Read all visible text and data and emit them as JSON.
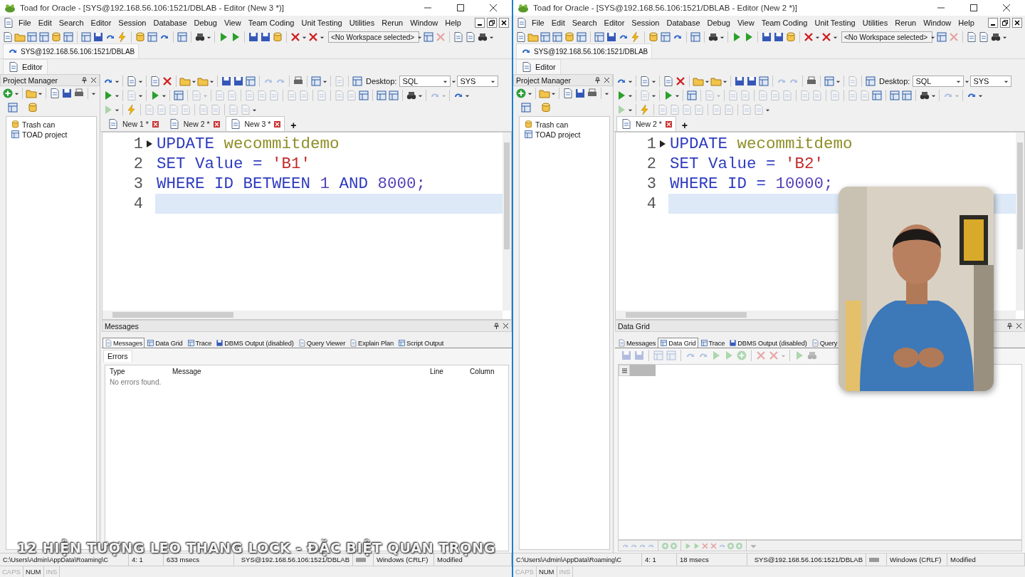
{
  "windows": [
    {
      "title": "Toad for Oracle - [SYS@192.168.56.106:1521/DBLAB - Editor (New 3 *)]",
      "menu": [
        "File",
        "Edit",
        "Search",
        "Editor",
        "Session",
        "Database",
        "Debug",
        "View",
        "Team Coding",
        "Unit Testing",
        "Utilities",
        "Rerun",
        "Window",
        "Help"
      ],
      "workspace": "<No Workspace selected>",
      "connection": "SYS@192.168.56.106:1521/DBLAB",
      "editor_tab": "Editor",
      "project_manager": {
        "title": "Project Manager",
        "items": [
          "Trash can",
          "TOAD project"
        ]
      },
      "desktop_label": "Desktop:",
      "desktop_value": "SQL",
      "schema": "SYS",
      "doc_tabs": [
        {
          "label": "New 1 *",
          "selected": false
        },
        {
          "label": "New 2 *",
          "selected": false
        },
        {
          "label": "New 3 *",
          "selected": true
        }
      ],
      "add_tab": "+",
      "code_lines": [
        {
          "number": "1",
          "marker": true,
          "current": false,
          "tokens": [
            {
              "text": "UPDATE",
              "kind": "keyword"
            },
            {
              "text": "wecommitdemo",
              "kind": "name"
            }
          ]
        },
        {
          "number": "2",
          "marker": false,
          "current": false,
          "tokens": [
            {
              "text": "SET",
              "kind": "keyword"
            },
            {
              "text": "Value",
              "kind": "keyword"
            },
            {
              "text": "=",
              "kind": "keyword"
            },
            {
              "text": "'B1'",
              "kind": "string"
            }
          ]
        },
        {
          "number": "3",
          "marker": false,
          "current": false,
          "tokens": [
            {
              "text": "WHERE",
              "kind": "keyword"
            },
            {
              "text": "ID",
              "kind": "keyword"
            },
            {
              "text": "BETWEEN",
              "kind": "keyword"
            },
            {
              "text": "1",
              "kind": "number"
            },
            {
              "text": "AND",
              "kind": "keyword"
            },
            {
              "text": "8000;",
              "kind": "number"
            }
          ]
        },
        {
          "number": "4",
          "marker": false,
          "current": true
        }
      ],
      "panel": {
        "kind": "messages",
        "title": "Messages",
        "tabs": [
          {
            "label": "Messages",
            "selected": true
          },
          {
            "label": "Data Grid",
            "selected": false
          },
          {
            "label": "Trace",
            "selected": false
          },
          {
            "label": "DBMS Output (disabled)",
            "selected": false
          },
          {
            "label": "Query Viewer",
            "selected": false
          },
          {
            "label": "Explain Plan",
            "selected": false
          },
          {
            "label": "Script Output",
            "selected": false
          }
        ],
        "subtab": "Errors",
        "columns": [
          "Type",
          "Message",
          "Line",
          "Column"
        ],
        "empty_text": "No errors found."
      },
      "status": {
        "path": "C:\\Users\\Admin\\AppData\\Roaming\\C",
        "position": "4:  1",
        "time": "633 msecs",
        "connection": "SYS@192.168.56.106:1521/DBLAB",
        "line_ending": "Windows (CRLF)",
        "state": "Modified"
      },
      "keys": [
        {
          "label": "CAPS",
          "on": false
        },
        {
          "label": "NUM",
          "on": true
        },
        {
          "label": "INS",
          "on": false
        }
      ]
    },
    {
      "title": "Toad for Oracle - [SYS@192.168.56.106:1521/DBLAB - Editor (New 2 *)]",
      "menu": [
        "File",
        "Edit",
        "Search",
        "Editor",
        "Session",
        "Database",
        "Debug",
        "View",
        "Team Coding",
        "Unit Testing",
        "Utilities",
        "Rerun",
        "Window",
        "Help"
      ],
      "workspace": "<No Workspace selected>",
      "connection": "SYS@192.168.56.106:1521/DBLAB",
      "editor_tab": "Editor",
      "project_manager": {
        "title": "Project Manager",
        "items": [
          "Trash can",
          "TOAD project"
        ]
      },
      "desktop_label": "Desktop:",
      "desktop_value": "SQL",
      "schema": "SYS",
      "doc_tabs": [
        {
          "label": "New 2 *",
          "selected": true
        }
      ],
      "add_tab": "+",
      "code_lines": [
        {
          "number": "1",
          "marker": true,
          "current": false,
          "tokens": [
            {
              "text": "UPDATE",
              "kind": "keyword"
            },
            {
              "text": "wecommitdemo",
              "kind": "name"
            }
          ]
        },
        {
          "number": "2",
          "marker": false,
          "current": false,
          "tokens": [
            {
              "text": "SET",
              "kind": "keyword"
            },
            {
              "text": "Value",
              "kind": "keyword"
            },
            {
              "text": "=",
              "kind": "keyword"
            },
            {
              "text": "'B2'",
              "kind": "string"
            }
          ]
        },
        {
          "number": "3",
          "marker": false,
          "current": false,
          "tokens": [
            {
              "text": "WHERE",
              "kind": "keyword"
            },
            {
              "text": "ID",
              "kind": "keyword"
            },
            {
              "text": "=",
              "kind": "keyword"
            },
            {
              "text": "10000;",
              "kind": "number"
            }
          ]
        },
        {
          "number": "4",
          "marker": false,
          "current": true
        }
      ],
      "panel": {
        "kind": "data_grid",
        "title": "Data Grid",
        "tabs": [
          {
            "label": "Messages",
            "selected": false
          },
          {
            "label": "Data Grid",
            "selected": true
          },
          {
            "label": "Trace",
            "selected": false
          },
          {
            "label": "DBMS Output (disabled)",
            "selected": false
          },
          {
            "label": "Query",
            "selected": false
          }
        ]
      },
      "status": {
        "path": "C:\\Users\\Admin\\AppData\\Roaming\\C",
        "position": "4:  1",
        "time": "18 msecs",
        "connection": "SYS@192.168.56.106:1521/DBLAB",
        "line_ending": "Windows (CRLF)",
        "state": "Modified"
      },
      "keys": [
        {
          "label": "CAPS",
          "on": false
        },
        {
          "label": "NUM",
          "on": true
        },
        {
          "label": "INS",
          "on": false
        }
      ]
    }
  ],
  "caption": "12 HIỆN TƯỢNG LEO THANG LOCK - ĐẶC BIỆT QUAN TRỌNG"
}
